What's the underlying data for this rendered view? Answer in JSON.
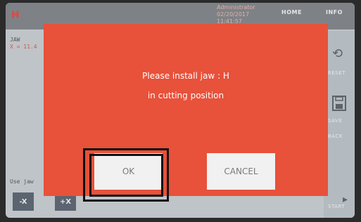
{
  "header": {
    "logo": "H",
    "user": "Administrator",
    "date": "02/20/2017",
    "time": "11:41:57",
    "home_label": "HOME",
    "info_label": "INFO"
  },
  "left_panel": {
    "jaw_label": "JAW",
    "coord": "X = 11.4",
    "use_jaw": "Use jaw"
  },
  "controls": {
    "minus_x": "-X",
    "plus_x": "+X"
  },
  "right_panel": {
    "reset": "RESET",
    "save": "SAVE",
    "back": "BACK",
    "start": "START"
  },
  "dialog": {
    "line1": "Please install jaw : H",
    "line2": "in cutting position",
    "ok": "OK",
    "cancel": "CANCEL"
  },
  "colors": {
    "dialog_bg": "#e8513a",
    "button_bg": "#f1f1f1"
  }
}
